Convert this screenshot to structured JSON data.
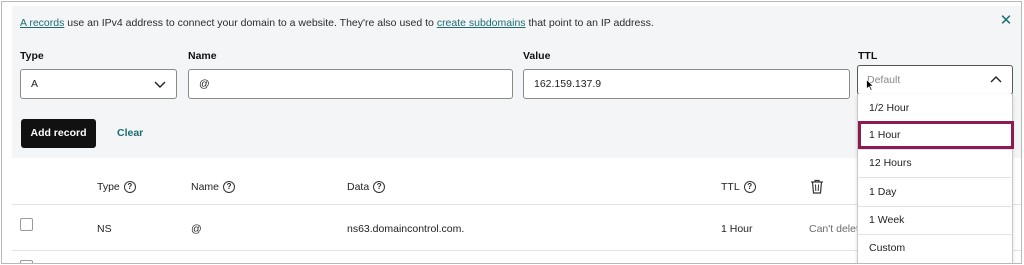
{
  "banner": {
    "link1": "A records",
    "text1": " use an IPv4 address to connect your domain to a website. They're also used to ",
    "link2": "create subdomains",
    "text2": " that point to an IP address."
  },
  "form": {
    "type_label": "Type",
    "type_value": "A",
    "name_label": "Name",
    "name_value": "@",
    "value_label": "Value",
    "value_value": "162.159.137.9",
    "ttl_label": "TTL",
    "ttl_placeholder": "Default",
    "add_button": "Add record",
    "clear_button": "Clear"
  },
  "ttl_options": [
    "1/2 Hour",
    "1 Hour",
    "12 Hours",
    "1 Day",
    "1 Week",
    "Custom"
  ],
  "ttl_highlighted": "1 Hour",
  "table": {
    "headers": {
      "type": "Type",
      "name": "Name",
      "data": "Data",
      "ttl": "TTL"
    },
    "rows": [
      {
        "type": "NS",
        "name": "@",
        "data": "ns63.domaincontrol.com.",
        "ttl": "1 Hour",
        "action": "Can't delete"
      }
    ]
  },
  "colors": {
    "accent": "#1b6c74",
    "highlight_border": "#8a1b53",
    "button_bg": "#111111",
    "panel_bg": "#f4f5f6"
  },
  "icons": {
    "close": "close-icon",
    "chevron_down": "chevron-down-icon",
    "chevron_up": "chevron-up-icon",
    "help": "help-icon",
    "trash": "trash-icon",
    "cursor": "mouse-cursor-icon"
  }
}
